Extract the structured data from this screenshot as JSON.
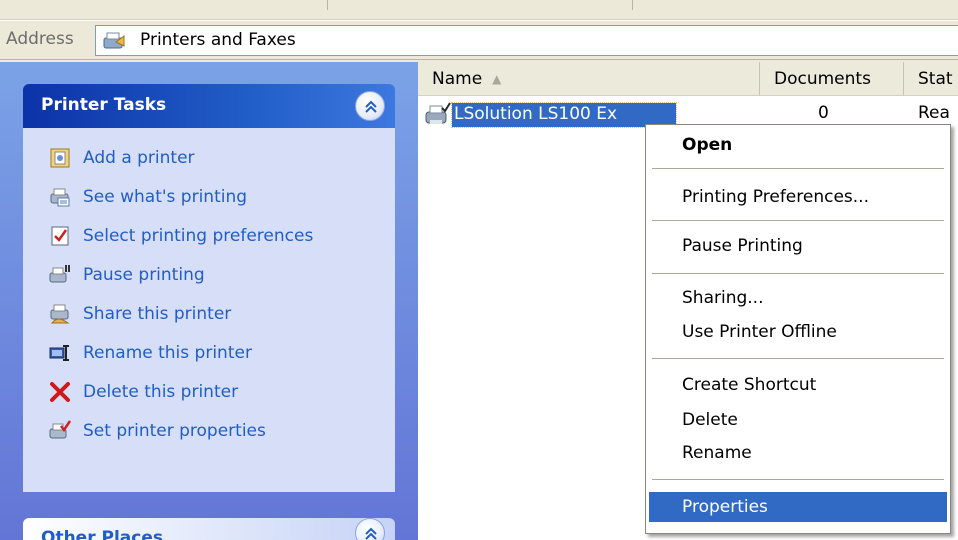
{
  "address": {
    "label": "Address",
    "value": "Printers and Faxes",
    "icon": "printers-folder-icon"
  },
  "task_pane": {
    "printer_tasks": {
      "title": "Printer Tasks",
      "items": [
        {
          "label": "Add a printer",
          "icon": "add-printer-icon"
        },
        {
          "label": "See what's printing",
          "icon": "printer-queue-icon"
        },
        {
          "label": "Select printing preferences",
          "icon": "preferences-icon"
        },
        {
          "label": "Pause printing",
          "icon": "pause-printer-icon"
        },
        {
          "label": "Share this printer",
          "icon": "share-printer-icon"
        },
        {
          "label": "Rename this printer",
          "icon": "rename-icon"
        },
        {
          "label": "Delete this printer",
          "icon": "delete-icon"
        },
        {
          "label": "Set printer properties",
          "icon": "printer-properties-icon"
        }
      ]
    },
    "other_places": {
      "title": "Other Places"
    }
  },
  "file_list": {
    "columns": [
      "Name",
      "Documents",
      "Stat"
    ],
    "sort_indicator": "▲",
    "rows": [
      {
        "name": "LSolution LS100 Ex",
        "documents": "0",
        "status": "Rea"
      }
    ]
  },
  "context_menu": {
    "items": [
      {
        "label": "Open",
        "bold": true
      },
      {
        "label": "Printing Preferences..."
      },
      {
        "label": "Pause Printing"
      },
      {
        "label": "Sharing..."
      },
      {
        "label": "Use Printer Offline"
      },
      {
        "label": "Create Shortcut"
      },
      {
        "label": "Delete"
      },
      {
        "label": "Rename"
      },
      {
        "label": "Properties",
        "selected": true
      }
    ]
  },
  "colors": {
    "selection": "#316ac5",
    "task_link": "#215dc6",
    "task_pane_bg": "#6375d6"
  }
}
